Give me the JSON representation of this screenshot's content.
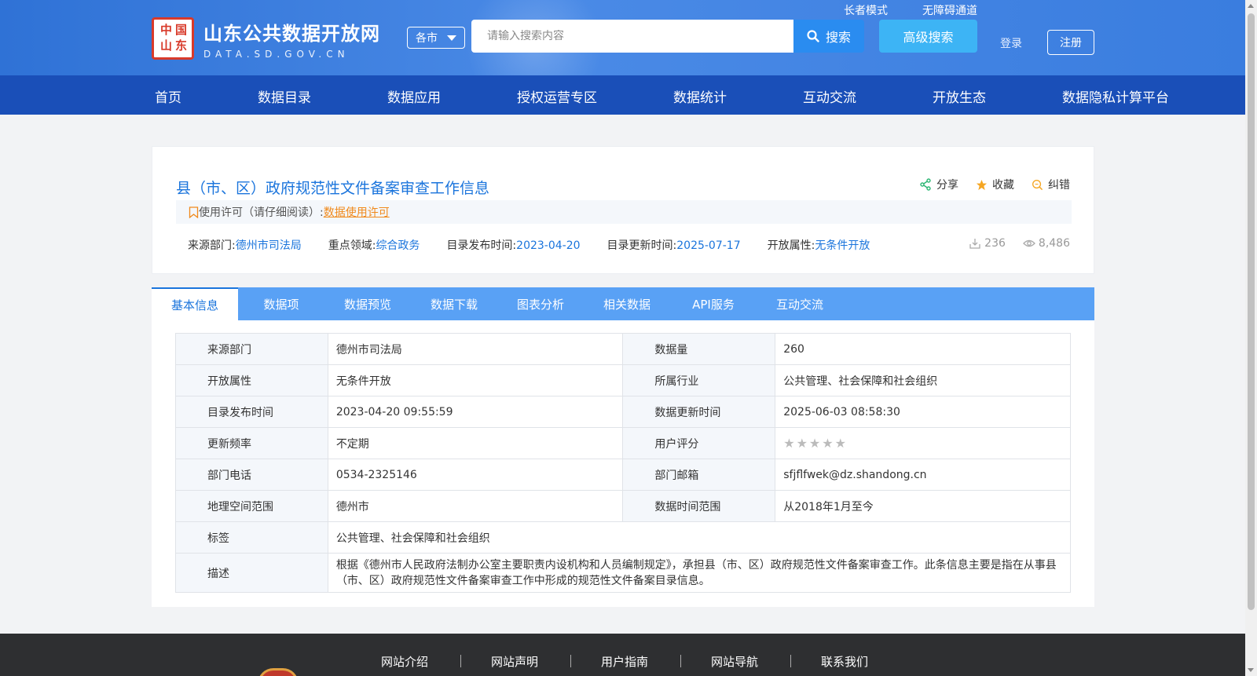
{
  "header": {
    "logo_title": "山东公共数据开放网",
    "logo_sub": "DATA.SD.GOV.CN",
    "seal_chars": [
      "中",
      "国",
      "山",
      "东"
    ],
    "city_select": "各市",
    "search_placeholder": "请输入搜索内容",
    "search_button": "搜索",
    "advanced_search": "高级搜索",
    "elder_mode": "长者模式",
    "accessible": "无障碍通道",
    "login": "登录",
    "register": "注册"
  },
  "nav": [
    "首页",
    "数据目录",
    "数据应用",
    "授权运营专区",
    "数据统计",
    "互动交流",
    "开放生态",
    "数据隐私计算平台"
  ],
  "dataset": {
    "title": "县（市、区）政府规范性文件备案审查工作信息",
    "actions": {
      "share": "分享",
      "favorite": "收藏",
      "report": "纠错"
    },
    "license_label": "使用许可（请仔细阅读）:",
    "license_link": "数据使用许可",
    "meta": [
      {
        "label": "来源部门:",
        "value": "德州市司法局"
      },
      {
        "label": "重点领域:",
        "value": "综合政务"
      },
      {
        "label": "目录发布时间:",
        "value": "2023-04-20"
      },
      {
        "label": "目录更新时间:",
        "value": "2025-07-17"
      },
      {
        "label": "开放属性:",
        "value": "无条件开放"
      }
    ],
    "downloads": "236",
    "views": "8,486"
  },
  "tabs": [
    "基本信息",
    "数据项",
    "数据预览",
    "数据下载",
    "图表分析",
    "相关数据",
    "API服务",
    "互动交流"
  ],
  "info": {
    "rows": [
      [
        "来源部门",
        "德州市司法局",
        "数据量",
        "260"
      ],
      [
        "开放属性",
        "无条件开放",
        "所属行业",
        "公共管理、社会保障和社会组织"
      ],
      [
        "目录发布时间",
        "2023-04-20 09:55:59",
        "数据更新时间",
        "2025-06-03 08:58:30"
      ],
      [
        "更新频率",
        "不定期",
        "用户评分",
        ""
      ],
      [
        "部门电话",
        "0534-2325146",
        "部门邮箱",
        "sfjflfwek@dz.shandong.cn"
      ],
      [
        "地理空间范围",
        "德州市",
        "数据时间范围",
        "从2018年1月至今"
      ]
    ],
    "rating": 0,
    "tag_label": "标签",
    "tag_value": "公共管理、社会保障和社会组织",
    "desc_label": "描述",
    "desc_value": "根据《德州市人民政府法制办公室主要职责内设机构和人员编制规定》，承担县（市、区）政府规范性文件备案审查工作。此条信息主要是指在从事县（市、区）政府规范性文件备案审查工作中形成的规范性文件备案目录信息。"
  },
  "footer": [
    "网站介绍",
    "网站声明",
    "用户指南",
    "网站导航",
    "联系我们"
  ],
  "colors": {
    "brand": "#1a4fb8",
    "link": "#1a74dc",
    "accent_orange": "#f08a1c",
    "tab_bar": "#59a1f5"
  }
}
